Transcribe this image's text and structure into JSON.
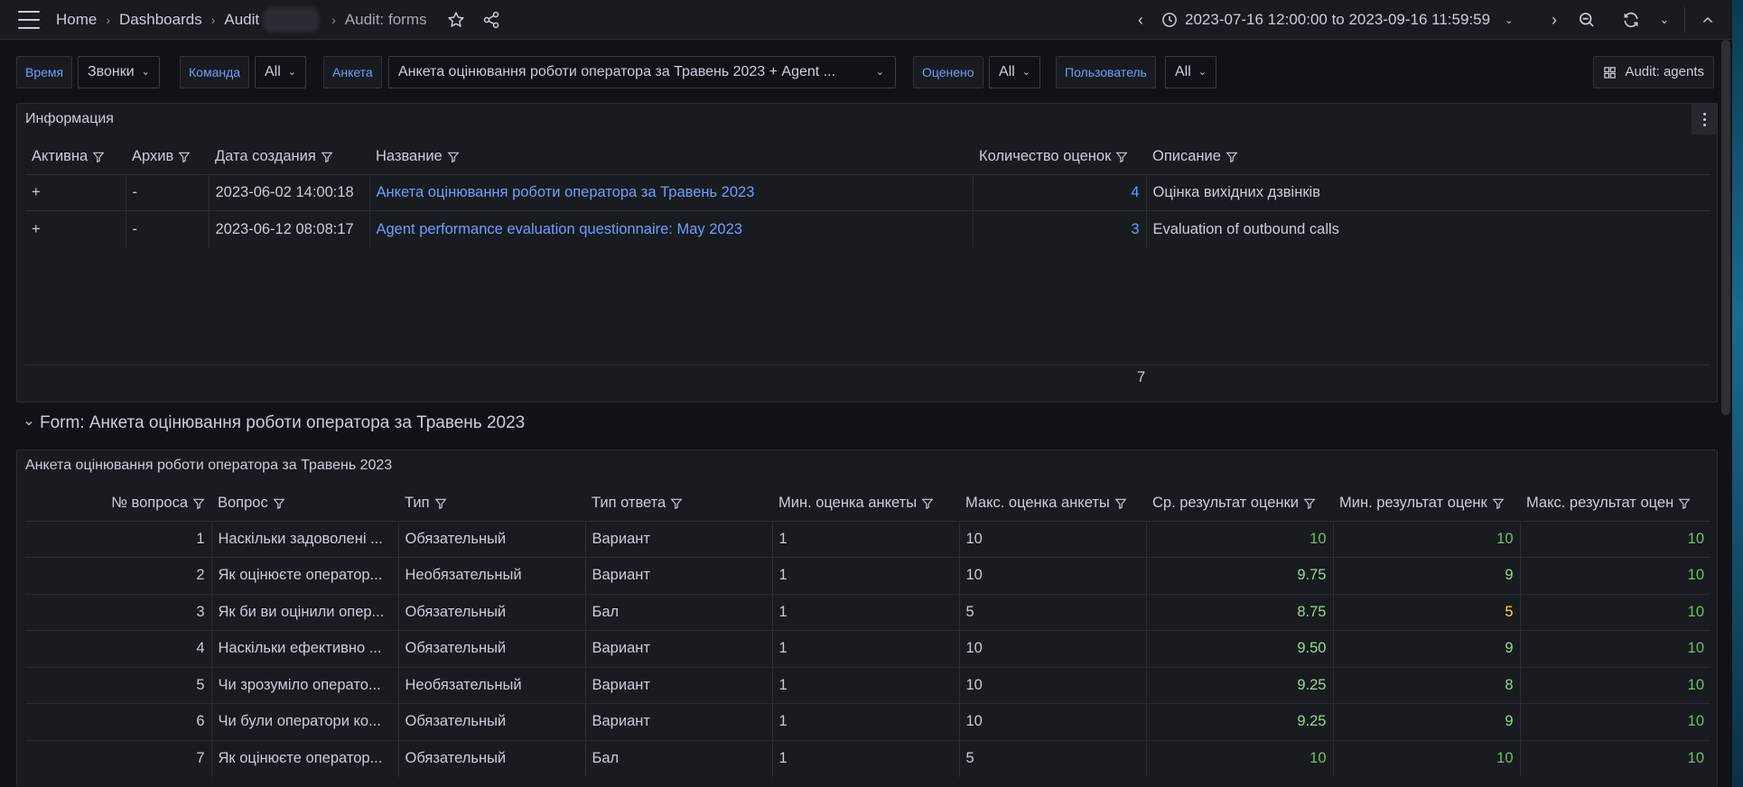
{
  "breadcrumb": {
    "home": "Home",
    "dashboards": "Dashboards",
    "folder": "Audit",
    "current": "Audit: forms"
  },
  "time": {
    "range": "2023-07-16 12:00:00 to 2023-09-16 11:59:59"
  },
  "variables": [
    {
      "label": "Время",
      "value": "Звонки"
    },
    {
      "label": "Команда",
      "value": "All"
    },
    {
      "label": "Анкета",
      "value": "Анкета оцінювання роботи оператора за Травень 2023 + Agent ..."
    },
    {
      "label": "Оценено",
      "value": "All"
    },
    {
      "label": "Пользователь",
      "value": "All"
    }
  ],
  "link_button": "Audit: agents",
  "info_panel": {
    "title": "Информация",
    "columns": [
      "Активна",
      "Архив",
      "Дата создания",
      "Название",
      "Количество оценок",
      "Описание"
    ],
    "rows": [
      [
        "+",
        "-",
        "2023-06-02 14:00:18",
        "Анкета оцінювання роботи оператора за Травень 2023",
        "4",
        "Оцінка вихідних дзвінків"
      ],
      [
        "+",
        "-",
        "2023-06-12 08:08:17",
        "Agent performance evaluation questionnaire: May 2023",
        "3",
        "Evaluation of outbound calls"
      ]
    ],
    "footer_total": "7"
  },
  "row_title": "Form: Анкета оцінювання роботи оператора за Травень 2023",
  "form_panel": {
    "title": "Анкета оцінювання роботи оператора за Травень 2023",
    "columns": [
      "№ вопроса",
      "Вопрос",
      "Тип",
      "Тип ответа",
      "Мин. оценка анкеты",
      "Макс. оценка анкеты",
      "Ср. результат оценки",
      "Мин. результат оценк",
      "Макс. результат оцен"
    ],
    "rows": [
      [
        "1",
        "Наскільки задоволені ...",
        "Обязательный",
        "Вариант",
        "1",
        "10",
        "10",
        "10",
        "10"
      ],
      [
        "2",
        "Як оцінюєте оператор...",
        "Необязательный",
        "Вариант",
        "1",
        "10",
        "9.75",
        "9",
        "10"
      ],
      [
        "3",
        "Як би ви оцінили опер...",
        "Обязательный",
        "Бал",
        "1",
        "5",
        "8.75",
        "5",
        "10"
      ],
      [
        "4",
        "Наскільки ефективно ...",
        "Обязательный",
        "Вариант",
        "1",
        "10",
        "9.50",
        "9",
        "10"
      ],
      [
        "5",
        "Чи зрозуміло операто...",
        "Необязательный",
        "Вариант",
        "1",
        "10",
        "9.25",
        "8",
        "10"
      ],
      [
        "6",
        "Чи були оператори ко...",
        "Обязательный",
        "Вариант",
        "1",
        "10",
        "9.25",
        "9",
        "10"
      ],
      [
        "7",
        "Як оцінюєте оператор...",
        "Обязательный",
        "Бал",
        "1",
        "5",
        "10",
        "10",
        "10"
      ]
    ]
  }
}
